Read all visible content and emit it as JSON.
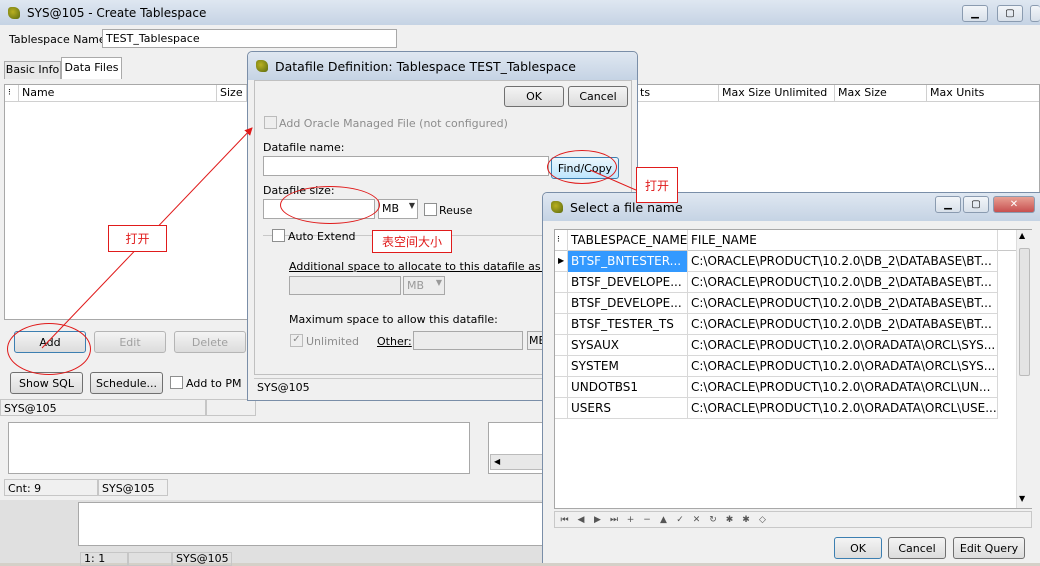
{
  "main_window": {
    "title": "SYS@105 - Create Tablespace",
    "tablespace_name_label": "Tablespace Name:",
    "tablespace_name_value": "TEST_Tablespace",
    "tabs": [
      {
        "label": "Basic Info"
      },
      {
        "label": "Data Files"
      }
    ],
    "columns": [
      "Name",
      "Size",
      "ts",
      "Max Size Unlimited",
      "Max Size",
      "Max Units"
    ],
    "buttons": {
      "add": "Add",
      "edit": "Edit",
      "delete": "Delete",
      "show_sql": "Show SQL",
      "schedule": "Schedule...",
      "add_to_pm": "Add to PM"
    },
    "status_left": "SYS@105",
    "cnt": "Cnt: 9",
    "cnt_conn": "SYS@105",
    "bottom_pos": "1:  1",
    "bottom_conn": "SYS@105"
  },
  "datafile_dialog": {
    "title": "Datafile Definition: Tablespace TEST_Tablespace",
    "ok": "OK",
    "cancel": "Cancel",
    "add_omf": "Add Oracle Managed File (not configured)",
    "datafile_name_label": "Datafile name:",
    "find_copy": "Find/Copy",
    "datafile_size_label": "Datafile size:",
    "size_unit": "MB",
    "reuse": "Reuse",
    "auto_extend": "Auto Extend",
    "additional_space": "Additional space to allocate to this datafile as needed",
    "ext_unit": "MB",
    "max_space": "Maximum space to allow this datafile:",
    "unlimited": "Unlimited",
    "other": "Other:",
    "other_unit": "MB",
    "status": "SYS@105"
  },
  "file_dialog": {
    "title": "Select a file name",
    "columns": [
      "TABLESPACE_NAME",
      "FILE_NAME"
    ],
    "rows": [
      {
        "tablespace": "BTSF_BNTESTER...",
        "file": "C:\\ORACLE\\PRODUCT\\10.2.0\\DB_2\\DATABASE\\BT..."
      },
      {
        "tablespace": "BTSF_DEVELOPE...",
        "file": "C:\\ORACLE\\PRODUCT\\10.2.0\\DB_2\\DATABASE\\BT..."
      },
      {
        "tablespace": "BTSF_DEVELOPE...",
        "file": "C:\\ORACLE\\PRODUCT\\10.2.0\\DB_2\\DATABASE\\BT..."
      },
      {
        "tablespace": "BTSF_TESTER_TS",
        "file": "C:\\ORACLE\\PRODUCT\\10.2.0\\DB_2\\DATABASE\\BT..."
      },
      {
        "tablespace": "SYSAUX",
        "file": "C:\\ORACLE\\PRODUCT\\10.2.0\\ORADATA\\ORCL\\SYS..."
      },
      {
        "tablespace": "SYSTEM",
        "file": "C:\\ORACLE\\PRODUCT\\10.2.0\\ORADATA\\ORCL\\SYS..."
      },
      {
        "tablespace": "UNDOTBS1",
        "file": "C:\\ORACLE\\PRODUCT\\10.2.0\\ORADATA\\ORCL\\UN..."
      },
      {
        "tablespace": "USERS",
        "file": "C:\\ORACLE\\PRODUCT\\10.2.0\\ORADATA\\ORCL\\USE..."
      }
    ],
    "nav_glyphs": [
      "⏮",
      "◀",
      "▶",
      "⏭",
      "+",
      "−",
      "▲",
      "✓",
      "✕",
      "↻",
      "✱",
      "✱",
      "◇"
    ],
    "ok": "OK",
    "cancel": "Cancel",
    "edit_query": "Edit Query"
  },
  "annotations": {
    "open_1": "打开",
    "open_2": "打开",
    "tablespace_size": "表空间大小"
  },
  "colors": {
    "annotation": "#e01b1b",
    "selection": "#3399ff"
  }
}
